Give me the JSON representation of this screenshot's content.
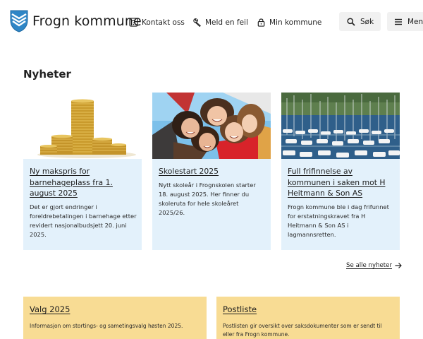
{
  "header": {
    "brand": "Frogn kommune",
    "nav": [
      {
        "label": "Kontakt oss",
        "icon": "question-icon"
      },
      {
        "label": "Meld en feil",
        "icon": "wrench-icon"
      },
      {
        "label": "Min kommune",
        "icon": "lock-icon"
      }
    ],
    "search_label": "Søk",
    "menu_label": "Meny"
  },
  "news": {
    "heading": "Nyheter",
    "cards": [
      {
        "title": "Ny makspris for barnehageplass fra 1. august 2025",
        "text": "Det er gjort endringer i foreldrebetalingen i barnehage etter revidert nasjonalbudsjett 20. juni 2025.",
        "image": "coin-stacks"
      },
      {
        "title": "Skolestart 2025",
        "text": "Nytt skoleår i Frognskolen starter 18. august 2025. Her finner du skoleruta for hele skoleåret 2025/26.",
        "image": "children-circle"
      },
      {
        "title": "Full frifinnelse av kommunen i saken mot H Heitmann & Son AS",
        "text": "Frogn kommune ble i dag frifunnet for erstatningskravet fra H Heitmann & Son AS i lagmannsretten.",
        "image": "marina-boats"
      }
    ],
    "see_all": "Se alle nyheter"
  },
  "boxes": [
    {
      "title": "Valg 2025",
      "text": "Informasjon om stortings- og sametingsvalg høsten 2025."
    },
    {
      "title": "Postliste",
      "text": "Postlisten gir oversikt over saksdokumenter som er sendt til eller fra Frogn kommune."
    }
  ],
  "colors": {
    "card_bg": "#e3f1fb",
    "box_bg": "#f8dc94",
    "logo_blue": "#2f86c6",
    "button_bg": "#f1f1f1"
  }
}
